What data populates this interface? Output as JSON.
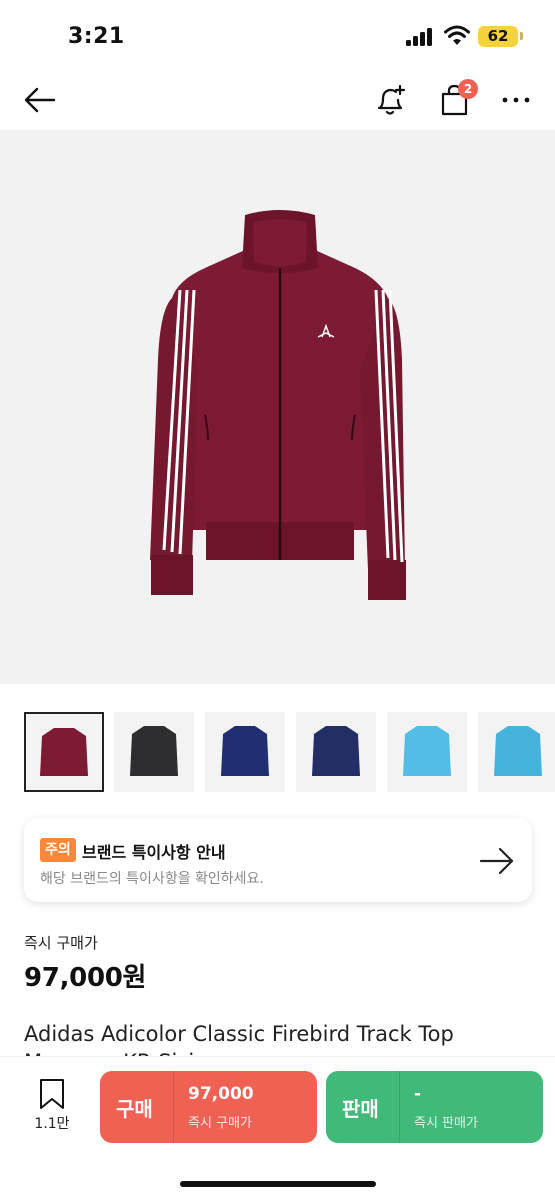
{
  "status_bar": {
    "time": "3:21",
    "battery": "62"
  },
  "header": {
    "cart_badge": "2"
  },
  "thumbnails": [
    {
      "name": "burgundy",
      "color": "#7d1a34"
    },
    {
      "name": "black",
      "color": "#2e2e30"
    },
    {
      "name": "navy",
      "color": "#1f2f72"
    },
    {
      "name": "dark-navy",
      "color": "#232e64"
    },
    {
      "name": "sky-blue",
      "color": "#53bde6"
    },
    {
      "name": "light-blue",
      "color": "#45b3dc"
    }
  ],
  "notice": {
    "tag": "주의",
    "title": "브랜드 특이사항 안내",
    "subtitle": "해당 브랜드의 특이사항을 확인하세요."
  },
  "price": {
    "label": "즉시 구매가",
    "value": "97,000원"
  },
  "product": {
    "name": "Adidas Adicolor Classic Firebird Track Top",
    "name_line2": "Maroon - KR Sizing"
  },
  "actions": {
    "wish_count": "1.1만",
    "buy": {
      "label": "구매",
      "price": "97,000",
      "sub": "즉시 구매가"
    },
    "sell": {
      "label": "판매",
      "price": "-",
      "sub": "즉시 판매가"
    }
  },
  "colors": {
    "buy": "#ef6253",
    "sell": "#41b979",
    "badge": "#ef6253",
    "notice_tag": "#f5883a",
    "jacket": "#7d1a34"
  },
  "icons": [
    "back-arrow-icon",
    "bell-plus-icon",
    "shopping-bag-icon",
    "more-icon",
    "arrow-right-icon",
    "bookmark-icon"
  ]
}
